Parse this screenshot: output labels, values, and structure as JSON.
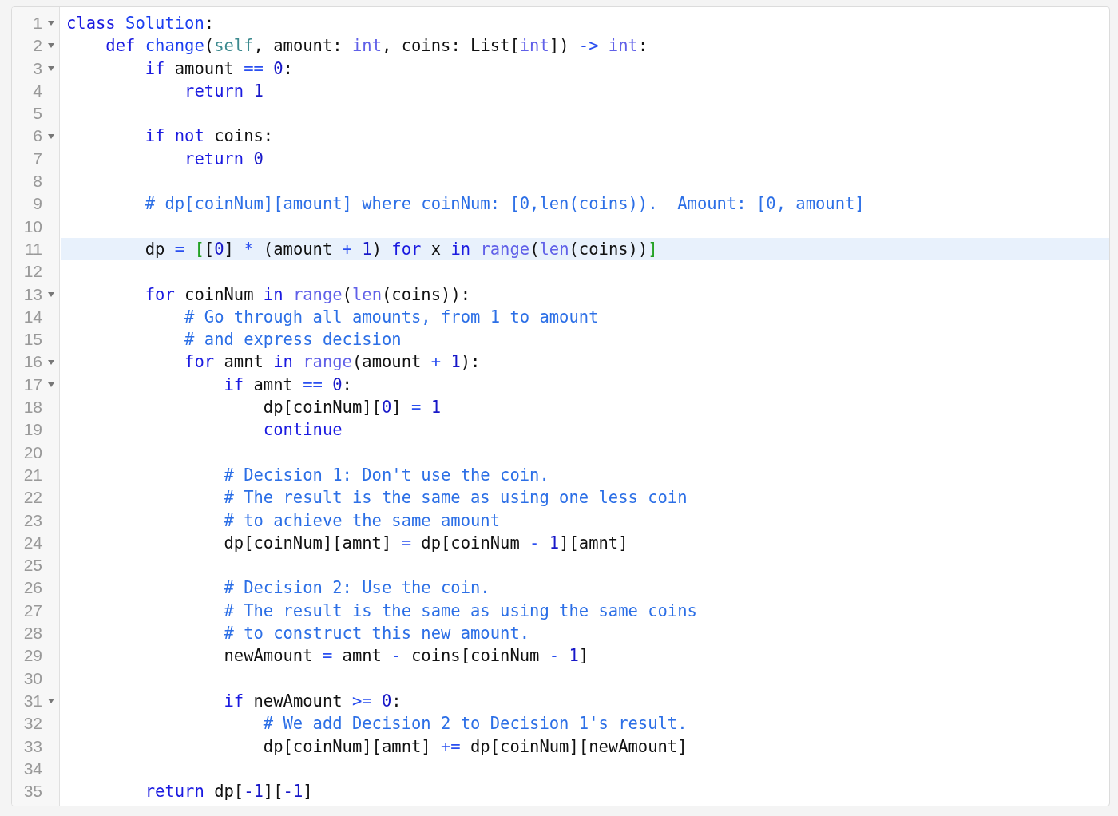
{
  "lines": [
    {
      "number": "1",
      "foldable": true,
      "highlighted": false,
      "tokens": [
        {
          "kind": "keyword",
          "text": "class"
        },
        {
          "kind": "definition",
          "text": " Solution"
        },
        {
          "kind": "plain",
          "text": ":"
        }
      ]
    },
    {
      "number": "2",
      "foldable": true,
      "highlighted": false,
      "tokens": [
        {
          "kind": "keyword",
          "text": "    def"
        },
        {
          "kind": "definition",
          "text": " change"
        },
        {
          "kind": "plain",
          "text": "("
        },
        {
          "kind": "self",
          "text": "self"
        },
        {
          "kind": "plain",
          "text": ", amount: "
        },
        {
          "kind": "builtin",
          "text": "int"
        },
        {
          "kind": "plain",
          "text": ", coins: List["
        },
        {
          "kind": "builtin",
          "text": "int"
        },
        {
          "kind": "plain",
          "text": "]) "
        },
        {
          "kind": "operator",
          "text": "->"
        },
        {
          "kind": "builtin",
          "text": " int"
        },
        {
          "kind": "plain",
          "text": ":"
        }
      ]
    },
    {
      "number": "3",
      "foldable": true,
      "highlighted": false,
      "tokens": [
        {
          "kind": "keyword",
          "text": "        if"
        },
        {
          "kind": "plain",
          "text": " amount "
        },
        {
          "kind": "operator",
          "text": "=="
        },
        {
          "kind": "number",
          "text": " 0"
        },
        {
          "kind": "plain",
          "text": ":"
        }
      ]
    },
    {
      "number": "4",
      "foldable": false,
      "highlighted": false,
      "tokens": [
        {
          "kind": "keyword",
          "text": "            return"
        },
        {
          "kind": "number",
          "text": " 1"
        }
      ]
    },
    {
      "number": "5",
      "foldable": false,
      "highlighted": false
    },
    {
      "number": "6",
      "foldable": true,
      "highlighted": false,
      "tokens": [
        {
          "kind": "keyword",
          "text": "        if"
        },
        {
          "kind": "keyword",
          "text": " not"
        },
        {
          "kind": "plain",
          "text": " coins:"
        }
      ]
    },
    {
      "number": "7",
      "foldable": false,
      "highlighted": false,
      "tokens": [
        {
          "kind": "keyword",
          "text": "            return"
        },
        {
          "kind": "number",
          "text": " 0"
        }
      ]
    },
    {
      "number": "8",
      "foldable": false,
      "highlighted": false
    },
    {
      "number": "9",
      "foldable": false,
      "highlighted": false,
      "tokens": [
        {
          "kind": "comment",
          "text": "        # dp[coinNum][amount] where coinNum: [0,len(coins)).  Amount: [0, amount]"
        }
      ]
    },
    {
      "number": "10",
      "foldable": false,
      "highlighted": false
    },
    {
      "number": "11",
      "foldable": false,
      "highlighted": true,
      "tokens": [
        {
          "kind": "plain",
          "text": "        dp "
        },
        {
          "kind": "operator",
          "text": "="
        },
        {
          "kind": "match",
          "text": " ["
        },
        {
          "kind": "plain",
          "text": "["
        },
        {
          "kind": "number",
          "text": "0"
        },
        {
          "kind": "plain",
          "text": "] "
        },
        {
          "kind": "operator",
          "text": "*"
        },
        {
          "kind": "plain",
          "text": " (amount "
        },
        {
          "kind": "operator",
          "text": "+"
        },
        {
          "kind": "number",
          "text": " 1"
        },
        {
          "kind": "plain",
          "text": ") "
        },
        {
          "kind": "keyword",
          "text": "for"
        },
        {
          "kind": "plain",
          "text": " x "
        },
        {
          "kind": "keyword",
          "text": "in"
        },
        {
          "kind": "builtin",
          "text": " range"
        },
        {
          "kind": "plain",
          "text": "("
        },
        {
          "kind": "builtin",
          "text": "len"
        },
        {
          "kind": "plain",
          "text": "(coins))"
        },
        {
          "kind": "match",
          "text": "]"
        }
      ]
    },
    {
      "number": "12",
      "foldable": false,
      "highlighted": false
    },
    {
      "number": "13",
      "foldable": true,
      "highlighted": false,
      "tokens": [
        {
          "kind": "keyword",
          "text": "        for"
        },
        {
          "kind": "plain",
          "text": " coinNum "
        },
        {
          "kind": "keyword",
          "text": "in"
        },
        {
          "kind": "builtin",
          "text": " range"
        },
        {
          "kind": "plain",
          "text": "("
        },
        {
          "kind": "builtin",
          "text": "len"
        },
        {
          "kind": "plain",
          "text": "(coins)):"
        }
      ]
    },
    {
      "number": "14",
      "foldable": false,
      "highlighted": false,
      "tokens": [
        {
          "kind": "comment",
          "text": "            # Go through all amounts, from 1 to amount"
        }
      ]
    },
    {
      "number": "15",
      "foldable": false,
      "highlighted": false,
      "tokens": [
        {
          "kind": "comment",
          "text": "            # and express decision"
        }
      ]
    },
    {
      "number": "16",
      "foldable": true,
      "highlighted": false,
      "tokens": [
        {
          "kind": "keyword",
          "text": "            for"
        },
        {
          "kind": "plain",
          "text": " amnt "
        },
        {
          "kind": "keyword",
          "text": "in"
        },
        {
          "kind": "builtin",
          "text": " range"
        },
        {
          "kind": "plain",
          "text": "(amount "
        },
        {
          "kind": "operator",
          "text": "+"
        },
        {
          "kind": "number",
          "text": " 1"
        },
        {
          "kind": "plain",
          "text": "):"
        }
      ]
    },
    {
      "number": "17",
      "foldable": true,
      "highlighted": false,
      "tokens": [
        {
          "kind": "keyword",
          "text": "                if"
        },
        {
          "kind": "plain",
          "text": " amnt "
        },
        {
          "kind": "operator",
          "text": "=="
        },
        {
          "kind": "number",
          "text": " 0"
        },
        {
          "kind": "plain",
          "text": ":"
        }
      ]
    },
    {
      "number": "18",
      "foldable": false,
      "highlighted": false,
      "tokens": [
        {
          "kind": "plain",
          "text": "                    dp[coinNum]["
        },
        {
          "kind": "number",
          "text": "0"
        },
        {
          "kind": "plain",
          "text": "] "
        },
        {
          "kind": "operator",
          "text": "="
        },
        {
          "kind": "number",
          "text": " 1"
        }
      ]
    },
    {
      "number": "19",
      "foldable": false,
      "highlighted": false,
      "tokens": [
        {
          "kind": "keyword",
          "text": "                    continue"
        }
      ]
    },
    {
      "number": "20",
      "foldable": false,
      "highlighted": false
    },
    {
      "number": "21",
      "foldable": false,
      "highlighted": false,
      "tokens": [
        {
          "kind": "comment",
          "text": "                # Decision 1: Don't use the coin."
        }
      ]
    },
    {
      "number": "22",
      "foldable": false,
      "highlighted": false,
      "tokens": [
        {
          "kind": "comment",
          "text": "                # The result is the same as using one less coin"
        }
      ]
    },
    {
      "number": "23",
      "foldable": false,
      "highlighted": false,
      "tokens": [
        {
          "kind": "comment",
          "text": "                # to achieve the same amount"
        }
      ]
    },
    {
      "number": "24",
      "foldable": false,
      "highlighted": false,
      "tokens": [
        {
          "kind": "plain",
          "text": "                dp[coinNum][amnt] "
        },
        {
          "kind": "operator",
          "text": "="
        },
        {
          "kind": "plain",
          "text": " dp[coinNum "
        },
        {
          "kind": "operator",
          "text": "-"
        },
        {
          "kind": "number",
          "text": " 1"
        },
        {
          "kind": "plain",
          "text": "][amnt]"
        }
      ]
    },
    {
      "number": "25",
      "foldable": false,
      "highlighted": false
    },
    {
      "number": "26",
      "foldable": false,
      "highlighted": false,
      "tokens": [
        {
          "kind": "comment",
          "text": "                # Decision 2: Use the coin."
        }
      ]
    },
    {
      "number": "27",
      "foldable": false,
      "highlighted": false,
      "tokens": [
        {
          "kind": "comment",
          "text": "                # The result is the same as using the same coins"
        }
      ]
    },
    {
      "number": "28",
      "foldable": false,
      "highlighted": false,
      "tokens": [
        {
          "kind": "comment",
          "text": "                # to construct this new amount."
        }
      ]
    },
    {
      "number": "29",
      "foldable": false,
      "highlighted": false,
      "tokens": [
        {
          "kind": "plain",
          "text": "                newAmount "
        },
        {
          "kind": "operator",
          "text": "="
        },
        {
          "kind": "plain",
          "text": " amnt "
        },
        {
          "kind": "operator",
          "text": "-"
        },
        {
          "kind": "plain",
          "text": " coins[coinNum "
        },
        {
          "kind": "operator",
          "text": "-"
        },
        {
          "kind": "number",
          "text": " 1"
        },
        {
          "kind": "plain",
          "text": "]"
        }
      ]
    },
    {
      "number": "30",
      "foldable": false,
      "highlighted": false
    },
    {
      "number": "31",
      "foldable": true,
      "highlighted": false,
      "tokens": [
        {
          "kind": "keyword",
          "text": "                if"
        },
        {
          "kind": "plain",
          "text": " newAmount "
        },
        {
          "kind": "operator",
          "text": ">="
        },
        {
          "kind": "number",
          "text": " 0"
        },
        {
          "kind": "plain",
          "text": ":"
        }
      ]
    },
    {
      "number": "32",
      "foldable": false,
      "highlighted": false,
      "tokens": [
        {
          "kind": "comment",
          "text": "                    # We add Decision 2 to Decision 1's result."
        }
      ]
    },
    {
      "number": "33",
      "foldable": false,
      "highlighted": false,
      "tokens": [
        {
          "kind": "plain",
          "text": "                    dp[coinNum][amnt] "
        },
        {
          "kind": "operator",
          "text": "+="
        },
        {
          "kind": "plain",
          "text": " dp[coinNum][newAmount]"
        }
      ]
    },
    {
      "number": "34",
      "foldable": false,
      "highlighted": false
    },
    {
      "number": "35",
      "foldable": false,
      "highlighted": false,
      "tokens": [
        {
          "kind": "keyword",
          "text": "        return"
        },
        {
          "kind": "plain",
          "text": " dp["
        },
        {
          "kind": "number",
          "text": "-1"
        },
        {
          "kind": "plain",
          "text": "]["
        },
        {
          "kind": "number",
          "text": "-1"
        },
        {
          "kind": "plain",
          "text": "]"
        }
      ]
    }
  ]
}
